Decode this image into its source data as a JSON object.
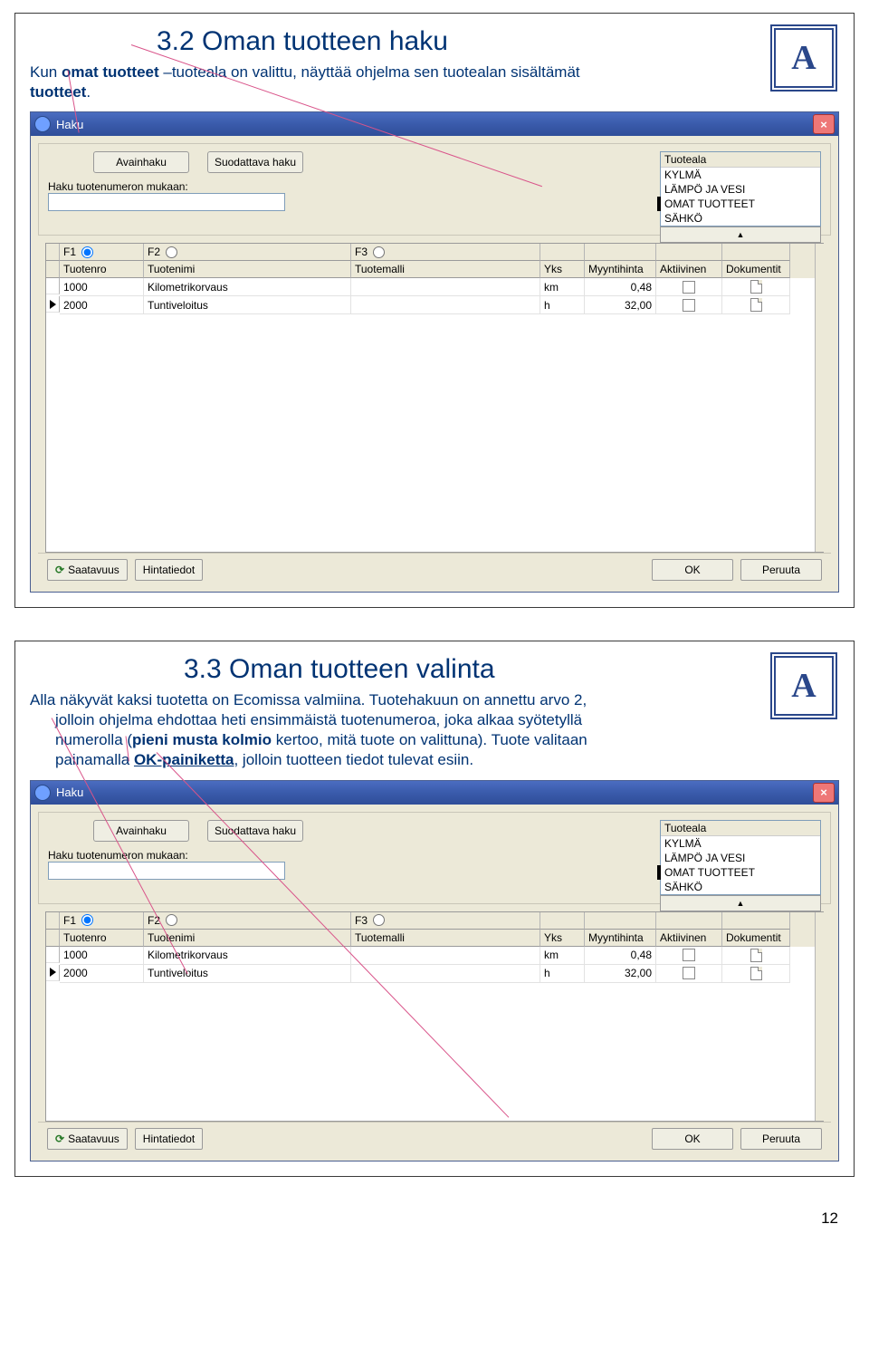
{
  "page_number": "12",
  "slide1": {
    "title": "3.2 Oman tuotteen haku",
    "intro_a": "Kun ",
    "intro_b": "omat tuotteet",
    "intro_c": " –tuoteala on valittu, näyttää ohjelma sen tuotealan sisältämät ",
    "intro_d": "tuotteet",
    "intro_e": "."
  },
  "slide2": {
    "title": "3.3 Oman tuotteen valinta",
    "l1a": "Alla näkyvät kaksi tuotetta on Ecomissa valmiina. Tuotehakuun on annettu arvo 2,",
    "l2": "jolloin ohjelma ehdottaa heti ensimmäistä tuotenumeroa, joka alkaa syötetyllä",
    "l3a": "numerolla (",
    "l3b": "pieni musta kolmio",
    "l3c": " kertoo, mitä tuote on valittuna). Tuote valitaan",
    "l4a": "painamalla ",
    "l4b": "OK-painiketta",
    "l4c": ", jolloin tuotteen tiedot tulevat esiin."
  },
  "win": {
    "title": "Haku",
    "avainhaku": "Avainhaku",
    "suodattava": "Suodattava haku",
    "label_haku": "Haku tuotenumeron mukaan:",
    "list_head": "Tuoteala",
    "list_items": [
      "KYLMÄ",
      "LÄMPÖ JA VESI",
      "OMAT TUOTTEET",
      "SÄHKÖ"
    ],
    "f1": "F1",
    "f2": "F2",
    "f3": "F3",
    "cols": {
      "c1": "Tuotenro",
      "c2": "Tuotenimi",
      "c3": "Tuotemalli",
      "c4": "Yks",
      "c5": "Myyntihinta",
      "c6": "Aktiivinen",
      "c7": "Dokumentit"
    },
    "rows": [
      {
        "nro": "1000",
        "nimi": "Kilometrikorvaus",
        "malli": "",
        "yks": "km",
        "hinta": "0,48"
      },
      {
        "nro": "2000",
        "nimi": "Tuntiveloitus",
        "malli": "",
        "yks": "h",
        "hinta": "32,00"
      }
    ],
    "saatavuus": "Saatavuus",
    "hintatiedot": "Hintatiedot",
    "ok": "OK",
    "peruuta": "Peruuta"
  }
}
